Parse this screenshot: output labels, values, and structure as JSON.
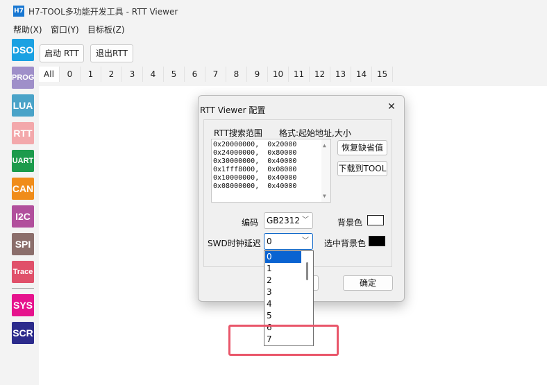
{
  "window": {
    "icon_text": "H7",
    "title": "H7-TOOL多功能开发工具 - RTT Viewer"
  },
  "menu": [
    "帮助(X)",
    "窗口(Y)",
    "目标板(Z)"
  ],
  "sidebar": [
    {
      "label": "DSO",
      "color": "#1ba1e2"
    },
    {
      "label": "PROG",
      "color": "#9f8fc9"
    },
    {
      "label": "LUA",
      "color": "#4aa3c8"
    },
    {
      "label": "RTT",
      "color": "#f3a8ab"
    },
    {
      "label": "UART",
      "color": "#1c9b4c"
    },
    {
      "label": "CAN",
      "color": "#f08c1a"
    },
    {
      "label": "I2C",
      "color": "#b14f9c"
    },
    {
      "label": "SPI",
      "color": "#8b6e6b"
    },
    {
      "label": "Trace",
      "color": "#e0506a"
    },
    {
      "label": "SYS",
      "color": "#e6138d"
    },
    {
      "label": "SCR",
      "color": "#2c2b8c"
    }
  ],
  "toolbar": {
    "start_label": "启动 RTT",
    "stop_label": "退出RTT"
  },
  "tabs": [
    "All",
    "0",
    "1",
    "2",
    "3",
    "4",
    "5",
    "6",
    "7",
    "8",
    "9",
    "10",
    "11",
    "12",
    "13",
    "14",
    "15"
  ],
  "dialog": {
    "title": "RTT Viewer 配置",
    "close": "✕",
    "range_label": "RTT搜索范围",
    "format_label": "格式:起始地址,大小",
    "ranges": [
      "0x20000000,  0x20000",
      "0x24000000,  0x80000",
      "0x30000000,  0x40000",
      "0x1fff8000,  0x08000",
      "0x10000000,  0x40000",
      "0x08000000,  0x40000"
    ],
    "restore_default": "恢复缺省值",
    "download_to_tool": "下载到TOOL",
    "encoding_label": "编码",
    "encoding_value": "GB2312",
    "bg_color_label": "背景色",
    "swd_label": "SWD时钟延迟",
    "swd_value": "0",
    "sel_bg_label": "选中背景色",
    "ok": "确定",
    "bg_color": "#ffffff",
    "sel_bg_color": "#000000"
  },
  "swd_options": [
    "0",
    "1",
    "2",
    "3",
    "4",
    "5",
    "6",
    "7"
  ]
}
